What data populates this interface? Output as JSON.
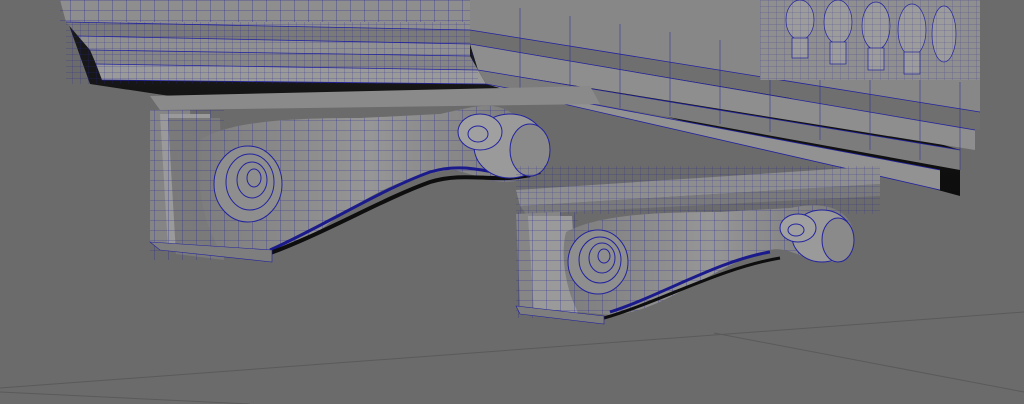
{
  "viewport": {
    "background_color": "#6b6b6b",
    "grid_line_color": "#585858",
    "mesh_fill_color": "#8c8c8c",
    "mesh_shadow_color": "#141414",
    "wireframe_color": "#1a1a8c"
  },
  "scene": {
    "objects": [
      "ground-grid",
      "cornice-slab",
      "balustrade",
      "corbel-bracket-left",
      "corbel-bracket-right"
    ]
  }
}
